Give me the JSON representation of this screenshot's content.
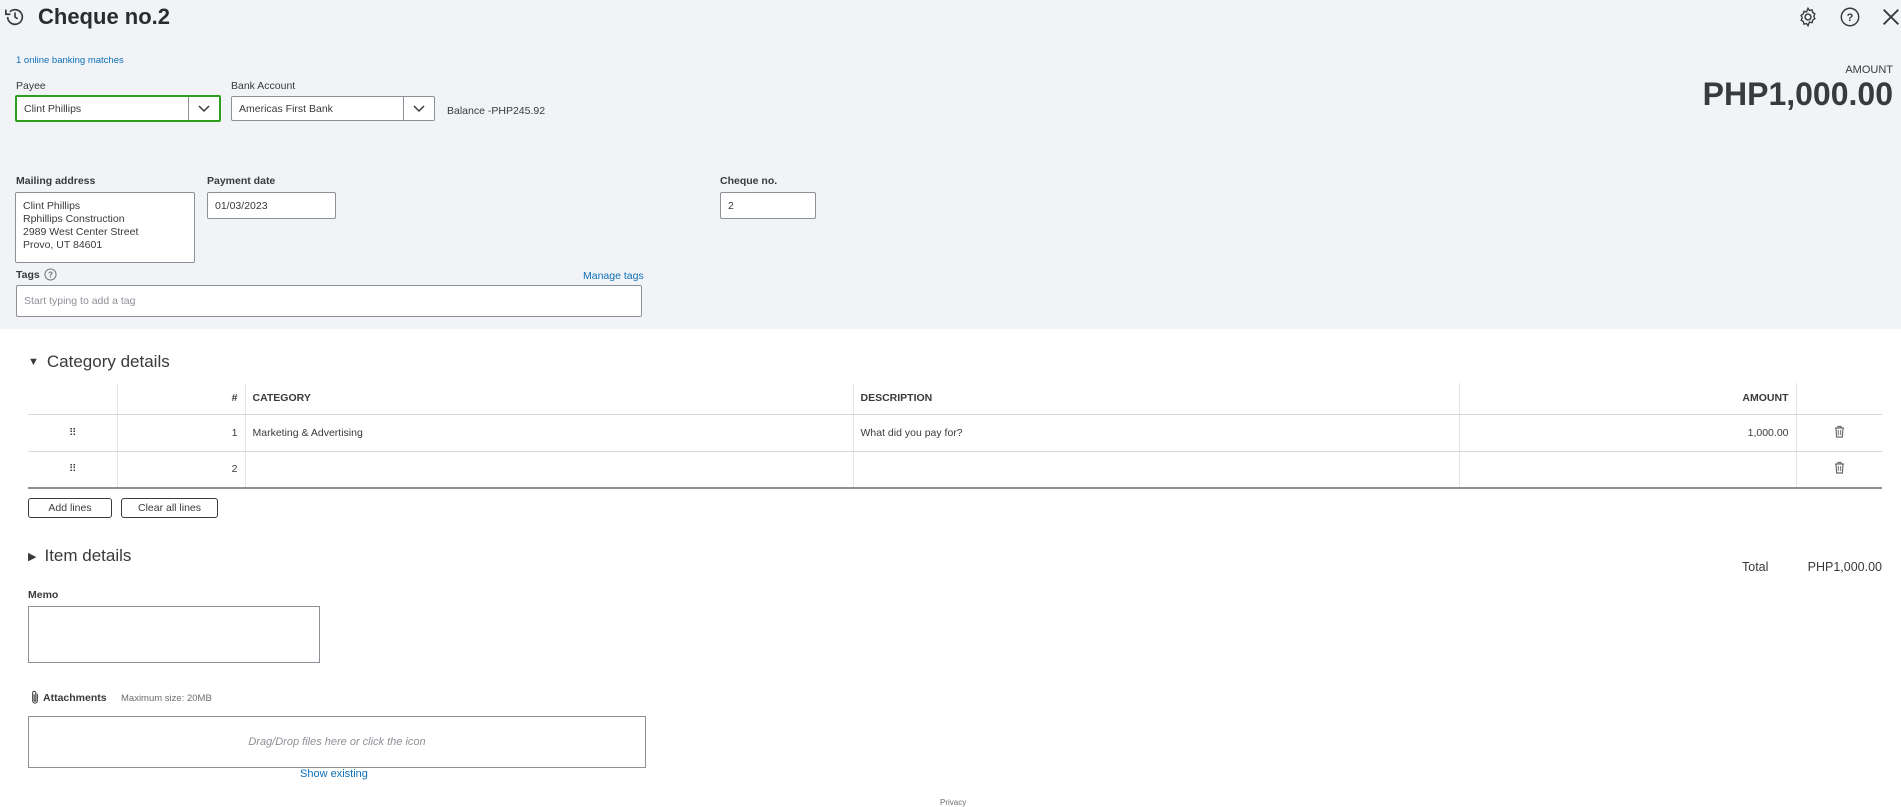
{
  "header": {
    "title": "Cheque no.2",
    "online_matches": "1 online banking matches"
  },
  "payee": {
    "label": "Payee",
    "value": "Clint Phillips"
  },
  "bank_account": {
    "label": "Bank Account",
    "value": "Americas First Bank",
    "balance": "Balance -PHP245.92"
  },
  "amount": {
    "label": "AMOUNT",
    "value": "PHP1,000.00"
  },
  "mailing": {
    "label": "Mailing address",
    "lines": [
      "Clint Phillips",
      "Rphillips Construction",
      "2989 West Center Street",
      "Provo, UT  84601"
    ]
  },
  "payment_date": {
    "label": "Payment date",
    "value": "01/03/2023"
  },
  "cheque_no": {
    "label": "Cheque no.",
    "value": "2"
  },
  "tags": {
    "label": "Tags",
    "manage": "Manage tags",
    "placeholder": "Start typing to add a tag"
  },
  "category_details": {
    "title": "Category details",
    "columns": {
      "num": "#",
      "category": "CATEGORY",
      "description": "DESCRIPTION",
      "amount": "AMOUNT"
    },
    "rows": [
      {
        "num": "1",
        "category": "Marketing & Advertising",
        "description_placeholder": "What did you pay for?",
        "amount": "1,000.00"
      },
      {
        "num": "2",
        "category": "",
        "description_placeholder": "",
        "amount": ""
      }
    ],
    "add_lines": "Add lines",
    "clear_lines": "Clear all lines"
  },
  "item_details": {
    "title": "Item details"
  },
  "total": {
    "label": "Total",
    "value": "PHP1,000.00"
  },
  "memo": {
    "label": "Memo"
  },
  "attachments": {
    "label": "Attachments",
    "max_size": "Maximum size: 20MB",
    "drop_text": "Drag/Drop files here or click the icon",
    "show_existing": "Show existing"
  },
  "footer": {
    "privacy": "Privacy"
  }
}
